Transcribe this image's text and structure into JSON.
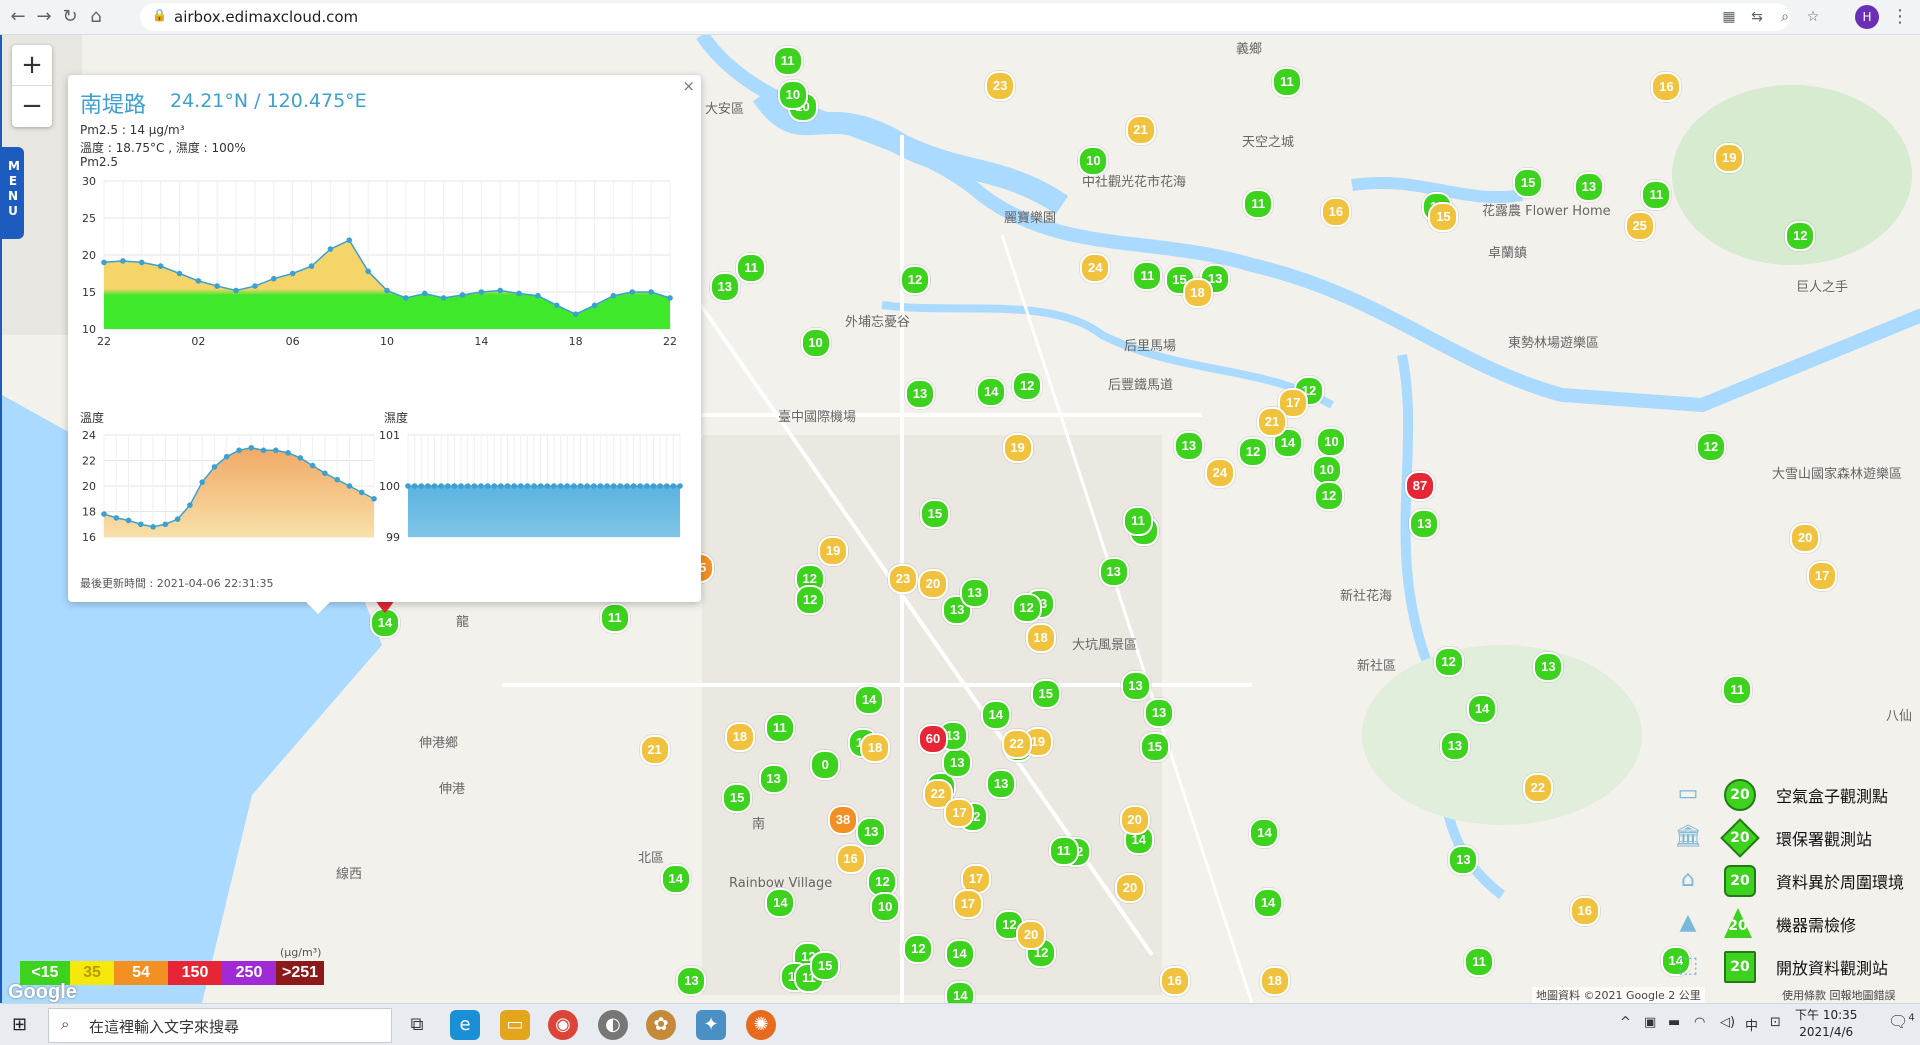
{
  "browser": {
    "url": "airbox.edimaxcloud.com",
    "profile_initial": "H"
  },
  "map": {
    "zoom_in": "+",
    "zoom_out": "−",
    "menu_label": "MENU",
    "places": [
      {
        "name": "大安區"
      },
      {
        "name": "中社觀光花市花海"
      },
      {
        "name": "麗寶樂園"
      },
      {
        "name": "外埔忘憂谷"
      },
      {
        "name": "后里馬場"
      },
      {
        "name": "后豐鐵馬道"
      },
      {
        "name": "臺中國際機場"
      },
      {
        "name": "卓蘭鎮"
      },
      {
        "name": "東勢林場遊樂區"
      },
      {
        "name": "巨人之手"
      },
      {
        "name": "新社花海"
      },
      {
        "name": "新社區"
      },
      {
        "name": "大雪山國家森林遊樂區"
      },
      {
        "name": "大坑風景區"
      },
      {
        "name": "伸港鄉"
      },
      {
        "name": "伸港"
      },
      {
        "name": "線西"
      },
      {
        "name": "Rainbow Village"
      },
      {
        "name": "花露農 Flower Home"
      },
      {
        "name": "天空之城"
      },
      {
        "name": "義鄉"
      },
      {
        "name": "北區"
      },
      {
        "name": "南"
      },
      {
        "name": "龍"
      },
      {
        "name": "八仙"
      }
    ]
  },
  "popup": {
    "close": "×",
    "title": "南堤路",
    "coords": "24.21°N / 120.475°E",
    "pm25_line": "Pm2.5 : 14 μg/m³",
    "temp_line": "溫度 : 18.75°C , 濕度 : 100%",
    "pm25_label": "Pm2.5",
    "temp_label": "溫度",
    "humidity_label": "濕度",
    "updated": "最後更新時間 : 2021-04-06 22:31:35"
  },
  "chart_data": [
    {
      "type": "area",
      "title": "Pm2.5",
      "x_ticks": [
        "22",
        "02",
        "06",
        "10",
        "14",
        "18",
        "22"
      ],
      "y_ticks": [
        "30",
        "25",
        "20",
        "15",
        "10"
      ],
      "ylim": [
        10,
        30
      ],
      "values": [
        19,
        19.2,
        19,
        18.5,
        17.5,
        16.5,
        15.8,
        15.2,
        15.8,
        16.8,
        17.5,
        18.5,
        20.8,
        22,
        17.8,
        15.2,
        14.2,
        14.8,
        14.2,
        14.6,
        15,
        15.2,
        14.8,
        14.5,
        13.2,
        12,
        13.2,
        14.5,
        15,
        15,
        14.2
      ]
    },
    {
      "type": "area",
      "title": "溫度",
      "y_ticks": [
        "24",
        "22",
        "20",
        "18",
        "16"
      ],
      "ylim": [
        16,
        24
      ],
      "values": [
        17.8,
        17.5,
        17.3,
        17,
        16.8,
        17,
        17.4,
        18.5,
        20.3,
        21.5,
        22.3,
        22.8,
        23,
        22.8,
        22.8,
        22.6,
        22.2,
        21.6,
        21,
        20.5,
        20,
        19.5,
        19
      ]
    },
    {
      "type": "area",
      "title": "濕度",
      "y_ticks": [
        "101",
        "100",
        "99"
      ],
      "ylim": [
        99,
        101
      ],
      "values": [
        100,
        100,
        100,
        100,
        100,
        100,
        100,
        100,
        100,
        100,
        100,
        100,
        100,
        100,
        100,
        100,
        100,
        100,
        100,
        100,
        100,
        100,
        100,
        100,
        100,
        100,
        100,
        100,
        100,
        100,
        100,
        100,
        100,
        100,
        100,
        100,
        100,
        100,
        100,
        100,
        100,
        100
      ]
    }
  ],
  "aqi_legend": {
    "unit": "(μg/m³)",
    "items": [
      {
        "label": "<15",
        "color": "#3cd21e"
      },
      {
        "label": "35",
        "color": "#f5e80c"
      },
      {
        "label": "54",
        "color": "#f29024"
      },
      {
        "label": "150",
        "color": "#e62634"
      },
      {
        "label": "250",
        "color": "#a02ad4"
      },
      {
        "label": ">251",
        "color": "#8c1a1a"
      }
    ]
  },
  "station_legend": [
    {
      "icon": "airbox-icon",
      "badge": "20",
      "label": "空氣盒子觀測點"
    },
    {
      "icon": "epa-building-icon",
      "badge": "20",
      "label": "環保署觀測站"
    },
    {
      "icon": "house-icon",
      "badge": "20",
      "label": "資料異於周圍環境"
    },
    {
      "icon": "cone-icon",
      "badge": "20",
      "label": "機器需檢修"
    },
    {
      "icon": "open-data-icon",
      "badge": "20",
      "label": "開放資料觀測站"
    }
  ],
  "attribution": {
    "google": "Google",
    "text": "地圖資料 ©2021 Google  2 公里",
    "terms": "使用條款  回報地圖錯誤"
  },
  "markers": {
    "green_values": [
      "12",
      "13",
      "9",
      "12",
      "10",
      "14",
      "13",
      "13",
      "12",
      "13",
      "10",
      "11",
      "0",
      "12",
      "13",
      "15",
      "10",
      "11",
      "14",
      "13",
      "12",
      "11",
      "12",
      "15",
      "12",
      "13",
      "11",
      "13",
      "14",
      "12",
      "13",
      "11",
      "14",
      "13",
      "12",
      "15",
      "10",
      "14",
      "13",
      "12",
      "11",
      "14",
      "15",
      "13",
      "12",
      "11",
      "10",
      "13",
      "14",
      "12",
      "15",
      "13",
      "11",
      "14",
      "12",
      "13",
      "10",
      "12",
      "14",
      "11",
      "13",
      "15",
      "12",
      "14",
      "13",
      "11",
      "12",
      "10",
      "13",
      "14",
      "15",
      "12",
      "11",
      "13",
      "14",
      "12",
      "10",
      "11",
      "13",
      "14",
      "12",
      "15",
      "13",
      "11",
      "14",
      "12"
    ],
    "yellow_values": [
      "17",
      "16",
      "18",
      "20",
      "21",
      "17",
      "19",
      "22",
      "24",
      "20",
      "17",
      "16",
      "18",
      "15",
      "19",
      "23",
      "20",
      "21",
      "16",
      "18",
      "17",
      "22",
      "25",
      "19",
      "20",
      "16",
      "18",
      "22",
      "23",
      "21",
      "17",
      "19",
      "24",
      "20",
      "18",
      "16"
    ],
    "special": [
      {
        "value": "60",
        "color": "red"
      },
      {
        "value": "87",
        "color": "red"
      },
      {
        "value": "38",
        "color": "orange"
      },
      {
        "value": "45",
        "color": "orange"
      },
      {
        "value": "14",
        "color": "green"
      }
    ]
  },
  "taskbar": {
    "search_placeholder": "在這裡輸入文字來搜尋",
    "time": "下午 10:35",
    "date": "2021/4/6",
    "ime": "中",
    "notif_count": "4"
  }
}
